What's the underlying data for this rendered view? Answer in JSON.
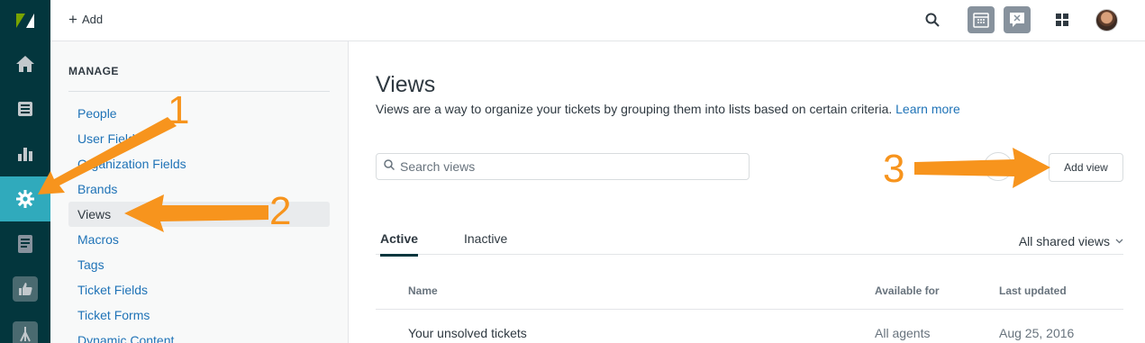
{
  "topbar": {
    "add_label": "Add"
  },
  "manage": {
    "title": "MANAGE",
    "items": [
      "People",
      "User Fields",
      "Organization Fields",
      "Brands",
      "Views",
      "Macros",
      "Tags",
      "Ticket Fields",
      "Ticket Forms",
      "Dynamic Content"
    ],
    "selected": "Views"
  },
  "main": {
    "title": "Views",
    "description": "Views are a way to organize your tickets by grouping them into lists based on certain criteria.",
    "learn_more": "Learn more",
    "search_placeholder": "Search views",
    "add_view_label": "Add view",
    "tabs": {
      "active": "Active",
      "inactive": "Inactive"
    },
    "filter_label": "All shared views",
    "table": {
      "headers": {
        "name": "Name",
        "available": "Available for",
        "updated": "Last updated"
      },
      "rows": [
        {
          "name": "Your unsolved tickets",
          "available": "All agents",
          "updated": "Aug 25, 2016"
        }
      ]
    }
  },
  "annotations": {
    "one": "1",
    "two": "2",
    "three": "3"
  },
  "colors": {
    "rail": "#03363d",
    "rail_active": "#30aabc",
    "link": "#1f73b7",
    "arrow": "#f7941d"
  }
}
